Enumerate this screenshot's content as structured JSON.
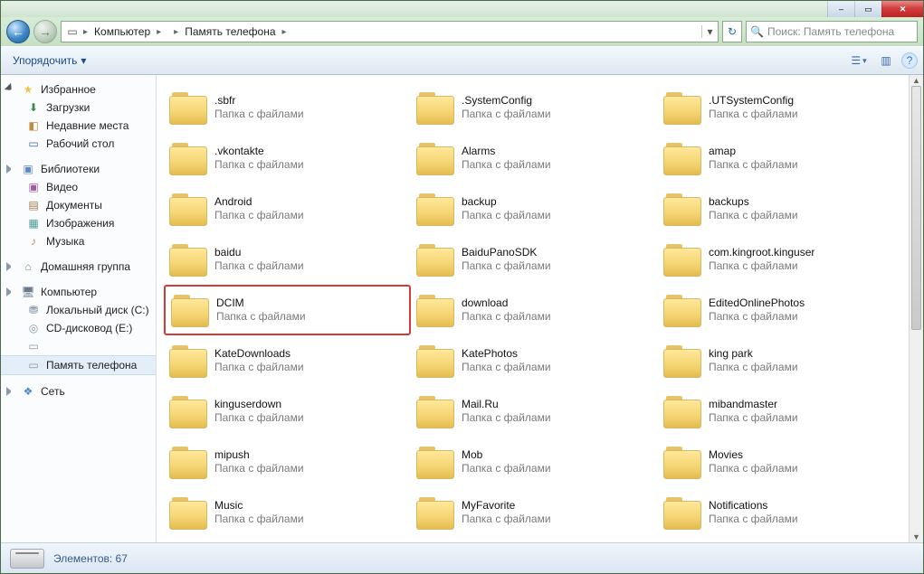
{
  "titlebar": {
    "min": "–",
    "max": "▭",
    "close": "✕"
  },
  "breadcrumb": {
    "segments": [
      "Компьютер",
      "",
      "Память телефона"
    ],
    "separator": "▸"
  },
  "refresh_glyph": "↻",
  "search": {
    "placeholder": "Поиск: Память телефона",
    "glyph": "🔍"
  },
  "toolbar": {
    "organize": "Упорядочить",
    "organize_arrow": "▾",
    "view_glyph": "☰",
    "pane_glyph": "▥",
    "help_glyph": "?"
  },
  "sidebar": {
    "favorites": {
      "label": "Избранное",
      "items": [
        {
          "label": "Загрузки",
          "cls": "dl",
          "glyph": "⬇"
        },
        {
          "label": "Недавние места",
          "cls": "recent",
          "glyph": "◧"
        },
        {
          "label": "Рабочий стол",
          "cls": "desk",
          "glyph": "▭"
        }
      ]
    },
    "libraries": {
      "label": "Библиотеки",
      "items": [
        {
          "label": "Видео",
          "cls": "vid",
          "glyph": "▣"
        },
        {
          "label": "Документы",
          "cls": "doc",
          "glyph": "▤"
        },
        {
          "label": "Изображения",
          "cls": "img",
          "glyph": "▦"
        },
        {
          "label": "Музыка",
          "cls": "mus",
          "glyph": "♪"
        }
      ]
    },
    "homegroup": {
      "label": "Домашняя группа",
      "glyph": "⌂"
    },
    "computer": {
      "label": "Компьютер",
      "items": [
        {
          "label": "Локальный диск (C:)",
          "cls": "disk",
          "glyph": "⛃"
        },
        {
          "label": "CD-дисковод (E:)",
          "cls": "cd",
          "glyph": "◎"
        },
        {
          "label": "",
          "cls": "drv",
          "glyph": "▭"
        },
        {
          "label": "Память телефона",
          "cls": "drv",
          "glyph": "▭",
          "selected": true
        }
      ]
    },
    "network": {
      "label": "Сеть",
      "glyph": "❖"
    }
  },
  "content": {
    "subtitle": "Папка с файлами",
    "folders_col1": [
      ".sbfr",
      ".vkontakte",
      "Android",
      "baidu",
      "DCIM",
      "KateDownloads",
      "kinguserdown",
      "mipush",
      "Music"
    ],
    "folders_col2": [
      ".SystemConfig",
      "Alarms",
      "backup",
      "BaiduPanoSDK",
      "download",
      "KatePhotos",
      "Mail.Ru",
      "Mob",
      "MyFavorite"
    ],
    "folders_col3": [
      ".UTSystemConfig",
      "amap",
      "backups",
      "com.kingroot.kinguser",
      "EditedOnlinePhotos",
      "king park",
      "mibandmaster",
      "Movies",
      "Notifications"
    ],
    "highlighted": "DCIM"
  },
  "status": {
    "label": "Элементов:",
    "count": "67"
  }
}
